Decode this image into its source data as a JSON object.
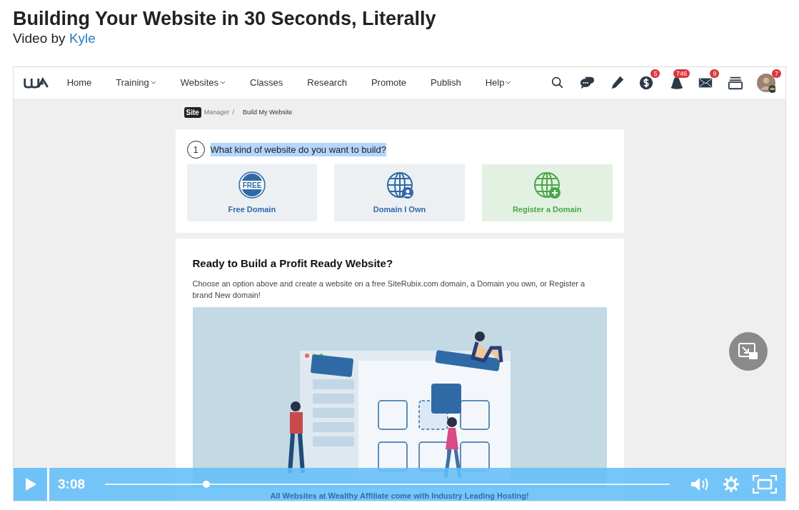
{
  "page": {
    "title": "Building Your Website in 30 Seconds, Literally",
    "byline_prefix": "Video by",
    "author": "Kyle"
  },
  "app": {
    "nav": [
      {
        "label": "Home",
        "dropdown": false
      },
      {
        "label": "Training",
        "dropdown": true
      },
      {
        "label": "Websites",
        "dropdown": true
      },
      {
        "label": "Classes",
        "dropdown": false
      },
      {
        "label": "Research",
        "dropdown": false
      },
      {
        "label": "Promote",
        "dropdown": false
      },
      {
        "label": "Publish",
        "dropdown": false
      },
      {
        "label": "Help",
        "dropdown": true
      }
    ],
    "tools": [
      {
        "kind": "search"
      },
      {
        "kind": "chat"
      },
      {
        "kind": "pencil"
      },
      {
        "kind": "dollar",
        "badge": "5"
      },
      {
        "kind": "bell",
        "badge": "746"
      },
      {
        "kind": "mail",
        "badge": "9"
      },
      {
        "kind": "archive"
      },
      {
        "kind": "avatar",
        "badge": "7"
      }
    ],
    "breadcrumb": {
      "logo": "Site",
      "section": "Manager",
      "separator": "/",
      "current": "Build My Website"
    },
    "step": {
      "number": "1",
      "question": "What kind of website do you want to build?",
      "highlighted": true
    },
    "options": [
      {
        "kind": "free",
        "icon_text": "FREE",
        "label": "Free Domain",
        "selected": false
      },
      {
        "kind": "own",
        "label": "Domain I Own",
        "selected": false
      },
      {
        "kind": "register",
        "label": "Register a Domain",
        "selected": true
      }
    ],
    "promo": {
      "title": "Ready to Build a Profit Ready Website?",
      "text": "Choose an option above and create a website on a free SiteRubix.com domain, a Domain you own, or Register a brand New domain!",
      "footer": "All Websites at Wealthy Affiliate come with Industry Leading Hosting!"
    }
  },
  "player": {
    "time": "3:08",
    "level": 0.18
  }
}
